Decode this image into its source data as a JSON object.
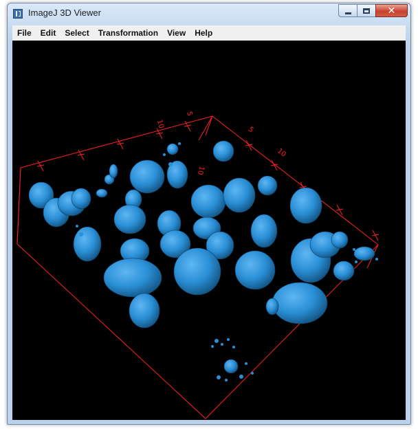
{
  "window": {
    "title": "ImageJ 3D Viewer",
    "icon": "imagej-3d-icon",
    "controls": [
      "minimize",
      "maximize",
      "close"
    ]
  },
  "menu": [
    "File",
    "Edit",
    "Select",
    "Transformation",
    "View",
    "Help"
  ],
  "viewer": {
    "background_color": "#000000",
    "bounding_box_color": "#ff2020",
    "surface_color": "#2a8fd6",
    "axis_labels": [
      "10",
      "5",
      "5",
      "10",
      "10"
    ]
  }
}
